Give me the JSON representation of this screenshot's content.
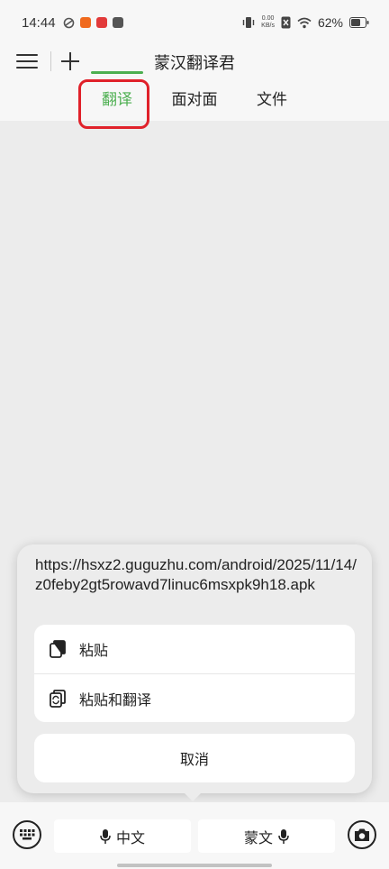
{
  "status_bar": {
    "time": "14:44",
    "net_speed_value": "0.00",
    "net_speed_unit": "KB/s",
    "battery": "62%",
    "icons": [
      "sync-icon",
      "app-notification-icon",
      "app-notification-icon",
      "app-notification-icon",
      "vibrate-icon",
      "sim-off-icon",
      "wifi-icon",
      "battery-icon"
    ]
  },
  "header": {
    "title": "蒙汉翻译君",
    "tabs": [
      "翻译",
      "面对面",
      "文件"
    ],
    "active_tab": "翻译"
  },
  "popup": {
    "clipboard_text": "https://hsxz2.guguzhu.com/android/2025/11/14/z0feby2gt5rowavd7linuc6msxpk9h18.apk",
    "paste_label": "粘贴",
    "paste_translate_label": "粘贴和翻译",
    "cancel_label": "取消"
  },
  "bottom_bar": {
    "source_lang": "中文",
    "target_lang": "蒙文"
  },
  "colors": {
    "accent": "#4caf50",
    "highlight": "#e0212a"
  }
}
